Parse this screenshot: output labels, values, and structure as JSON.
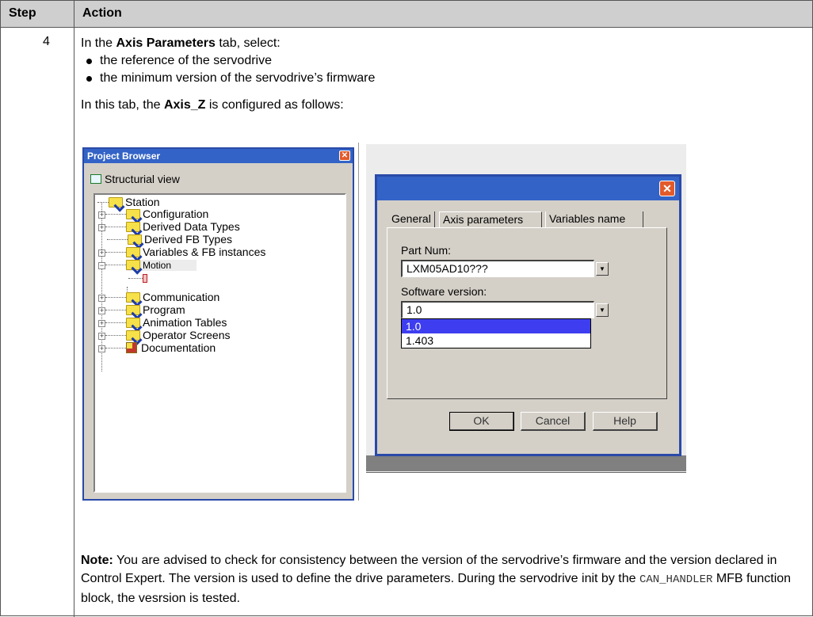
{
  "table": {
    "header": {
      "step": "Step",
      "action": "Action"
    },
    "row": {
      "step": "4",
      "intro_prefix": "In the ",
      "intro_bold": "Axis Parameters",
      "intro_suffix": " tab, select:",
      "bullets": [
        "the reference of the servodrive",
        "the minimum version of the servodrive’s firmware"
      ],
      "tab_prefix": "In this tab, the ",
      "tab_bold": "Axis_Z",
      "tab_suffix": " is configured as follows:",
      "note_label": "Note:",
      "note_text_1": " You are advised to check for consistency between the version of the servodrive’s firmware and the version declared in Control Expert. The version is used to define the drive parameters. During the servodrive init by the ",
      "note_code": "CAN_HANDLER",
      "note_text_2": " MFB function block, the vesrsion is tested."
    }
  },
  "project_browser": {
    "title": "Project Browser",
    "view_label": "Structurial view",
    "tree": [
      {
        "label": "Station",
        "icon": "folder-icon"
      },
      {
        "label": "Configuration",
        "icon": "folder-icon"
      },
      {
        "label": "Derived Data Types",
        "icon": "folder-icon"
      },
      {
        "label": "Derived FB Types",
        "icon": "folder-icon"
      },
      {
        "label": "Variables & FB instances",
        "icon": "folder-icon"
      },
      {
        "label": "Motion",
        "icon": "folder-icon"
      },
      {
        "label": "Communication",
        "icon": "folder-icon"
      },
      {
        "label": "Program",
        "icon": "folder-icon"
      },
      {
        "label": "Animation Tables",
        "icon": "folder-icon"
      },
      {
        "label": "Operator Screens",
        "icon": "folder-icon"
      },
      {
        "label": "Documentation",
        "icon": "documentation-icon"
      }
    ]
  },
  "dialog": {
    "tabs": [
      "General",
      "Axis parameters",
      "Variables name"
    ],
    "active_tab": "Axis parameters",
    "part_num_label": "Part Num:",
    "part_num_value": "LXM05AD10???",
    "software_version_label": "Software version:",
    "software_version_value": "1.0",
    "software_version_options": [
      "1.0",
      "1.403"
    ],
    "buttons": {
      "ok": "OK",
      "cancel": "Cancel",
      "help": "Help"
    }
  },
  "colors": {
    "title_bar": "#3363c6",
    "header_bg": "#cfcfcf",
    "selection": "#3e3ef0"
  }
}
